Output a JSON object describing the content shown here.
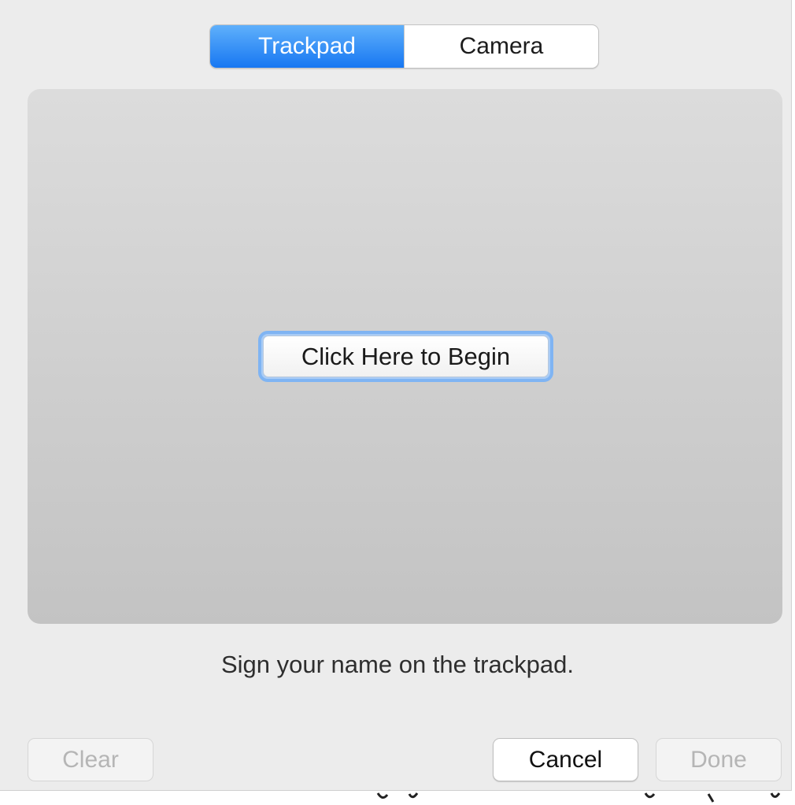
{
  "tabs": [
    {
      "label": "Trackpad",
      "selected": true
    },
    {
      "label": "Camera",
      "selected": false
    }
  ],
  "pad": {
    "begin_label": "Click Here to Begin"
  },
  "instruction": "Sign your name on the trackpad.",
  "buttons": {
    "clear": {
      "label": "Clear",
      "enabled": false
    },
    "cancel": {
      "label": "Cancel",
      "enabled": true
    },
    "done": {
      "label": "Done",
      "enabled": false
    }
  },
  "colors": {
    "accent": "#1a7cf5",
    "focus_ring": "#7fb4f3",
    "dialog_bg": "#ececec"
  }
}
